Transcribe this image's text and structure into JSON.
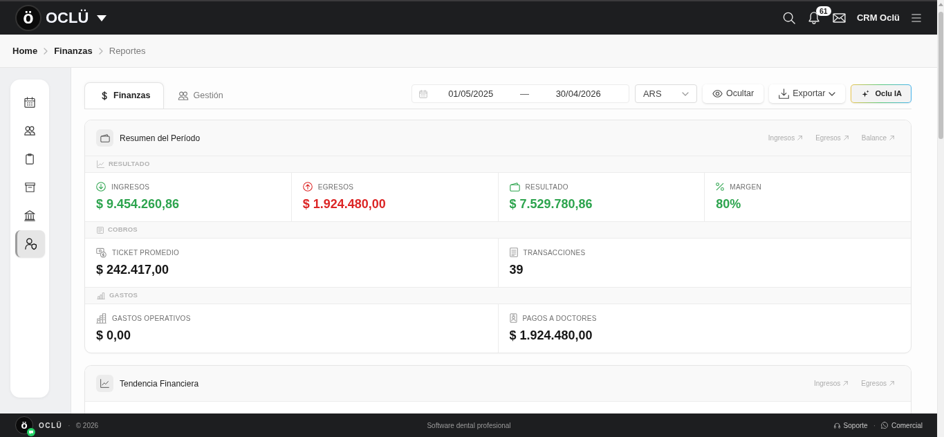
{
  "navbar": {
    "logo_letter": "ö",
    "brand": "OCLÜ",
    "notification_count": "61",
    "user_name": "CRM Oclü"
  },
  "breadcrumb": [
    {
      "label": "Home",
      "current": false
    },
    {
      "label": "Finanzas",
      "current": false
    },
    {
      "label": "Reportes",
      "current": true
    }
  ],
  "sidebar": {
    "items": [
      {
        "selected": false
      },
      {
        "selected": false
      },
      {
        "selected": false
      },
      {
        "selected": false
      },
      {
        "selected": false
      },
      {
        "selected": true
      }
    ]
  },
  "tabs": [
    {
      "label": "Finanzas",
      "selected": true
    },
    {
      "label": "Gestión",
      "selected": false
    }
  ],
  "filters": {
    "date_from": "01/05/2025",
    "date_separator": "—",
    "date_to": "30/04/2026",
    "currency": "ARS",
    "buttons": [
      {
        "label": "Ocultar",
        "kind": "plain"
      },
      {
        "label": "Exportar",
        "kind": "dropdown"
      },
      {
        "label": "Oclu IA",
        "kind": "ai"
      }
    ]
  },
  "summary": {
    "title": "Resumen del Período",
    "links": [
      "Ingresos",
      "Egresos",
      "Balance"
    ],
    "sections": [
      {
        "title": "RESULTADO",
        "stats": [
          {
            "label": "INGRESOS",
            "value": "$ 9.454.260,86",
            "color": "#2da44e"
          },
          {
            "label": "EGRESOS",
            "value": "$ 1.924.480,00",
            "color": "#dc2626"
          },
          {
            "label": "RESULTADO",
            "value": "$ 7.529.780,86",
            "color": "#2da44e"
          },
          {
            "label": "MARGEN",
            "value": "80%",
            "color": "#2da44e"
          }
        ]
      },
      {
        "title": "COBROS",
        "stats": [
          {
            "label": "TICKET PROMEDIO",
            "value": "$ 242.417,00"
          },
          {
            "label": "TRANSACCIONES",
            "value": "39"
          }
        ]
      },
      {
        "title": "GASTOS",
        "stats": [
          {
            "label": "GASTOS OPERATIVOS",
            "value": "$ 0,00"
          },
          {
            "label": "PAGOS A DOCTORES",
            "value": "$ 1.924.480,00"
          }
        ]
      }
    ]
  },
  "trend": {
    "title": "Tendencia Financiera",
    "links": [
      "Ingresos",
      "Egresos"
    ]
  },
  "footer": {
    "logo_letter": "ö",
    "brand": "OCLÜ",
    "separator": "·",
    "copyright": "© 2026",
    "tagline": "Software dental profesional",
    "links": [
      "Soporte",
      "Comercial"
    ],
    "links_separator": "·"
  }
}
